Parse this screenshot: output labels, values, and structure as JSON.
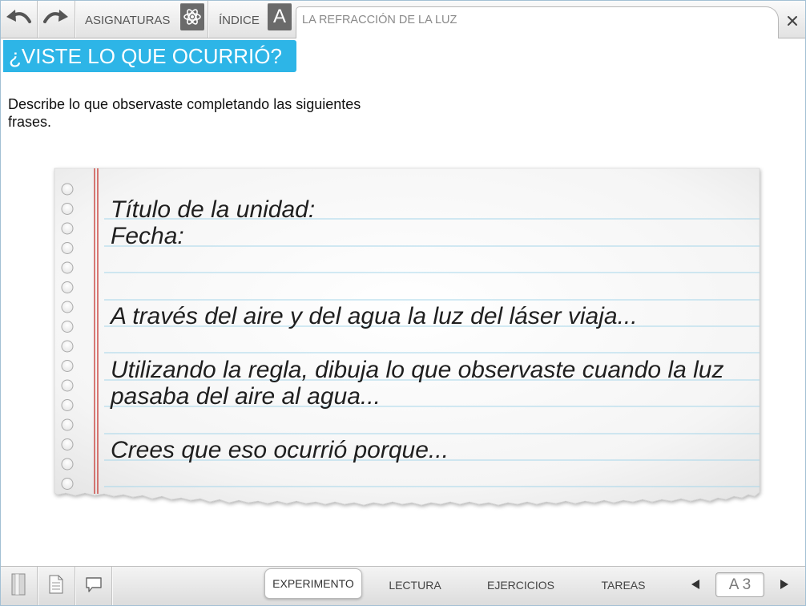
{
  "toolbar": {
    "subjects_label": "ASIGNATURAS",
    "index_label": "ÍNDICE",
    "index_letter": "A",
    "document_title": "LA REFRACCIÓN DE LA LUZ",
    "icons": {
      "undo": "undo-icon",
      "redo": "redo-icon",
      "subjects": "atom-icon",
      "close": "close-icon"
    }
  },
  "banner": {
    "title": "¿VISTE LO QUE OCURRIÓ?",
    "color": "#2db5e7"
  },
  "instructions": "Describe lo que observaste completando las siguientes frases.",
  "notebook": {
    "lines": [
      "Título de la unidad:",
      "Fecha:",
      "A través del aire y del agua la luz del láser viaja...",
      "Utilizando la regla, dibuja lo que observaste cuando la luz",
      "pasaba del aire al agua...",
      "Crees que eso ocurrió porque..."
    ],
    "margin_color": "#c8423c",
    "rule_color": "#a6d6ea"
  },
  "bottom_bar": {
    "icons": {
      "bookmark": "bookmark-icon",
      "notes": "page-icon",
      "comments": "comment-icon",
      "previous": "previous-page-icon",
      "next": "next-page-icon"
    },
    "tabs": [
      {
        "label": "EXPERIMENTO",
        "active": true
      },
      {
        "label": "LECTURA",
        "active": false
      },
      {
        "label": "EJERCICIOS",
        "active": false
      },
      {
        "label": "TAREAS",
        "active": false
      }
    ],
    "page_indicator": "A 3"
  }
}
